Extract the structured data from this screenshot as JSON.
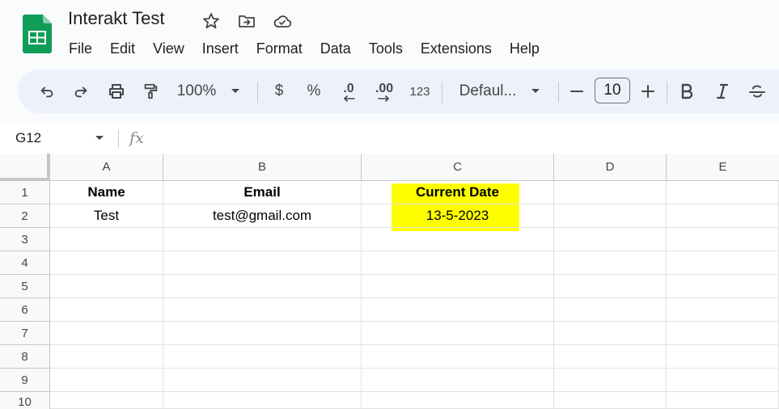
{
  "header": {
    "title": "Interakt Test",
    "icons": [
      "sheets-logo-icon",
      "star-icon",
      "move-to-folder-icon",
      "cloud-saved-icon"
    ]
  },
  "menu": [
    "File",
    "Edit",
    "View",
    "Insert",
    "Format",
    "Data",
    "Tools",
    "Extensions",
    "Help"
  ],
  "toolbar": {
    "zoom": "100%",
    "currency": "$",
    "percent": "%",
    "decrease_decimal": ".0",
    "increase_decimal": ".00",
    "number_format": "123",
    "font": "Defaul...",
    "font_size": "10",
    "icons": [
      "undo-icon",
      "redo-icon",
      "print-icon",
      "paint-format-icon",
      "chevron-down-icon",
      "minus-icon",
      "plus-icon",
      "bold-icon",
      "italic-icon",
      "strikethrough-icon"
    ]
  },
  "formula_bar": {
    "name_box": "G12",
    "fx": "fx"
  },
  "sheet": {
    "columns": [
      "A",
      "B",
      "C",
      "D",
      "E"
    ],
    "rows": [
      "1",
      "2",
      "3",
      "4",
      "5",
      "6",
      "7",
      "8",
      "9",
      "10"
    ],
    "cells": {
      "A1": "Name",
      "B1": "Email",
      "C1": "Current Date",
      "A2": "Test",
      "B2": "test@gmail.com",
      "C2": "13-5-2023"
    },
    "highlight_color": "#ffff00"
  },
  "colors": {
    "toolbar_bg": "#edf2fa",
    "sheets_green": "#0f9d58",
    "page_bg": "#f9fbfd"
  }
}
